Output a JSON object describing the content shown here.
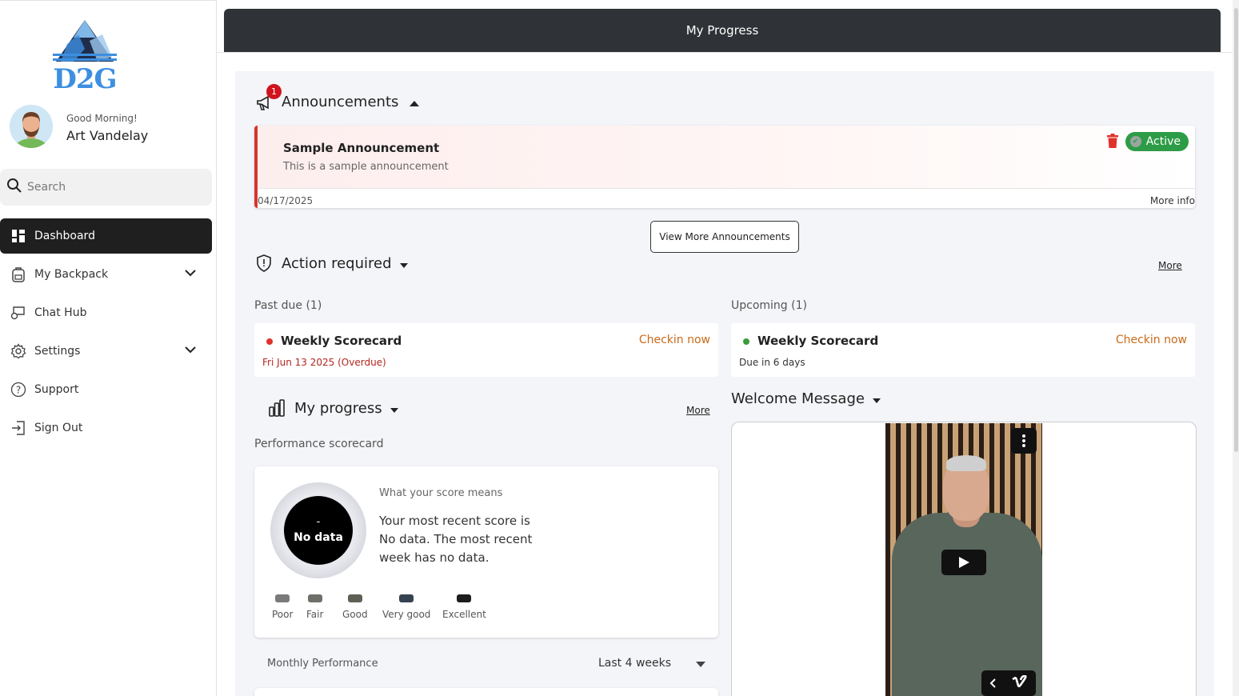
{
  "app": {
    "logo_text": "D2G"
  },
  "user": {
    "greeting": "Good Morning!",
    "name": "Art Vandelay"
  },
  "search": {
    "placeholder": "Search"
  },
  "sidebar": {
    "items": [
      {
        "label": "Dashboard",
        "icon": "dashboard-icon"
      },
      {
        "label": "My Backpack",
        "icon": "backpack-icon"
      },
      {
        "label": "Chat Hub",
        "icon": "chat-icon"
      },
      {
        "label": "Settings",
        "icon": "gear-icon"
      },
      {
        "label": "Support",
        "icon": "help-icon"
      },
      {
        "label": "Sign Out",
        "icon": "sign-out-icon"
      }
    ]
  },
  "header": {
    "title": "My Progress"
  },
  "announcements": {
    "title": "Announcements",
    "badge_count": "1",
    "card": {
      "title": "Sample Announcement",
      "body": "This is a sample announcement",
      "date": "04/17/2025",
      "more": "More info",
      "status": "Active"
    },
    "view_more": "View More Announcements"
  },
  "action_required": {
    "title": "Action required",
    "more": "More",
    "past_due": {
      "label": "Past due (1)",
      "task": "Weekly Scorecard",
      "action": "Checkin now",
      "date": "Fri Jun 13 2025 (Overdue)"
    },
    "upcoming": {
      "label": "Upcoming (1)",
      "task": "Weekly Scorecard",
      "action": "Checkin now",
      "date": "Due in 6 days"
    }
  },
  "progress": {
    "title": "My progress",
    "more": "More",
    "subtitle": "Performance scorecard",
    "score_dash": "-",
    "score_value": "No data",
    "meaning_title": "What your score means",
    "meaning_text": "Your most recent score is No data. The most recent week has no data.",
    "legend": [
      "Poor",
      "Fair",
      "Good",
      "Very good",
      "Excellent"
    ],
    "legend_colors": [
      "#7a7a7a",
      "#6f6f6a",
      "#5f5f55",
      "#354350",
      "#1d1d1d"
    ],
    "monthly_label": "Monthly Performance",
    "period": "Last 4 weeks"
  },
  "welcome": {
    "title": "Welcome Message"
  },
  "colors": {
    "accent_dark": "#1f1f1f",
    "alert_red": "#d9342b",
    "active_green": "#2e9c47",
    "action_orange": "#c96b1a"
  }
}
